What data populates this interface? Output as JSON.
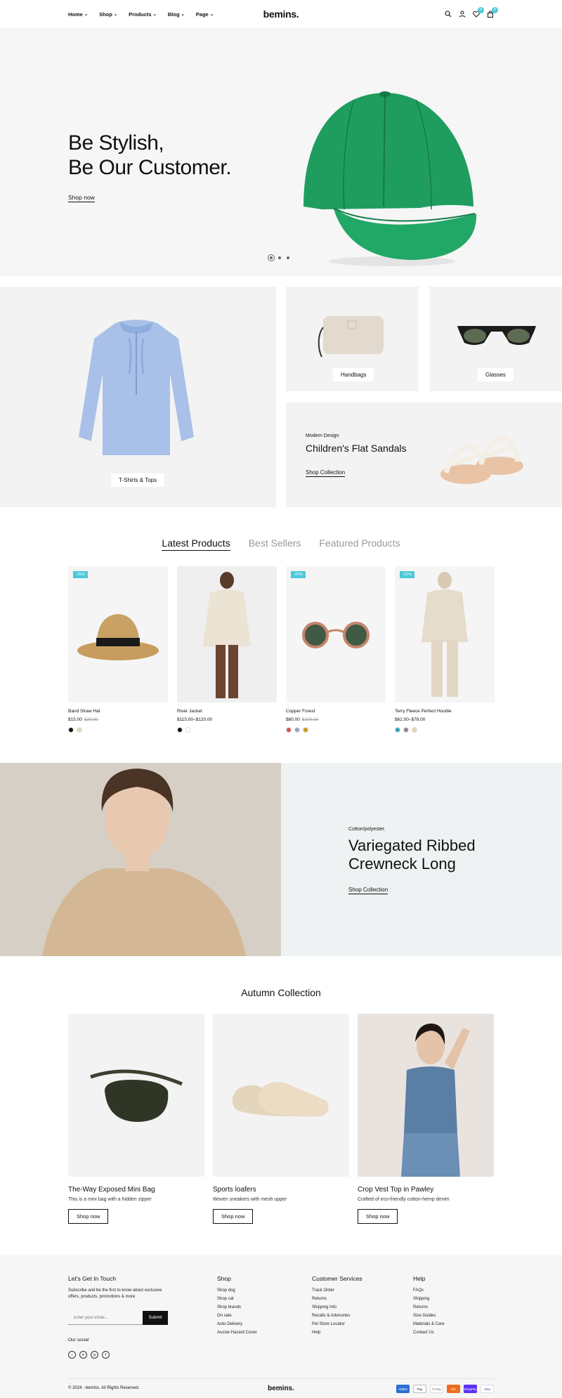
{
  "header": {
    "nav": [
      "Home",
      "Shop",
      "Products",
      "Blog",
      "Page"
    ],
    "logo": "bemins.",
    "wishlist_count": "0",
    "cart_count": "0"
  },
  "hero": {
    "line1": "Be Stylish,",
    "line2": "Be Our Customer.",
    "cta": "Shop now"
  },
  "categories": {
    "tops": "T-Shirts & Tops",
    "handbags": "Handbags",
    "glasses": "Glasses",
    "sandals": {
      "eyebrow": "Modern Design",
      "title": "Children's Flat Sandals",
      "cta": "Shop Collection"
    }
  },
  "tabs": [
    "Latest Products",
    "Best Sellers",
    "Featured Products"
  ],
  "products": [
    {
      "name": "Band Straw Hat",
      "price": "$15.00",
      "old": "$20.00",
      "badge": "-25%",
      "swatches": [
        "#111111",
        "#e8d3b5"
      ]
    },
    {
      "name": "River Jacket",
      "price": "$115.00–$120.00",
      "old": "",
      "badge": "",
      "swatches": [
        "#111111",
        "#ffffff"
      ]
    },
    {
      "name": "Copper Forest",
      "price": "$80.00",
      "old": "$100.00",
      "badge": "-20%",
      "swatches": [
        "#d9534f",
        "#9aa4c7",
        "#c99a1a"
      ]
    },
    {
      "name": "Terry Fleece Perfect Hoodie",
      "price": "$62.00–$78.00",
      "old": "",
      "badge": "-21%",
      "swatches": [
        "#2aa6b8",
        "#8a8a8a",
        "#e8d3b5"
      ]
    }
  ],
  "banner": {
    "eyebrow": "Cotton/polyester.",
    "line1": "Variegated Ribbed",
    "line2": "Crewneck Long",
    "cta": "Shop Collection"
  },
  "autumn": {
    "title": "Autumn Collection",
    "items": [
      {
        "title": "The-Way Exposed Mini Bag",
        "desc": "This is a mini bag with a hidden zipper",
        "cta": "Shop now"
      },
      {
        "title": "Sports loafers",
        "desc": "Woven sneakers with mesh upper",
        "cta": "Shop now"
      },
      {
        "title": "Crop Vest Top in Pawley",
        "desc": "Crafted of eco-friendly cotton-hemp denim",
        "cta": "Shop now"
      }
    ]
  },
  "footer": {
    "contact": {
      "title": "Let's Get In Touch",
      "text1": "Subscribe and be the first to know about exclusive",
      "text2": "offers, products, promotions & more",
      "placeholder": "Enter your email...",
      "submit": "Submit",
      "social_label": "Our social"
    },
    "shop": {
      "title": "Shop",
      "links": [
        "Shop dog",
        "Shop cat",
        "Shop brands",
        "On sale",
        "Auto-Delivery",
        "Aussie Hazard Cover"
      ]
    },
    "service": {
      "title": "Customer Services",
      "links": [
        "Track Order",
        "Returns",
        "Shipping Info",
        "Recalls & Advisories",
        "Pet Store Locator",
        "Help"
      ]
    },
    "help": {
      "title": "Help",
      "links": [
        "FAQs",
        "Shipping",
        "Returns",
        "Size Guides",
        "Materials & Care",
        "Contact Us"
      ]
    },
    "copyright": "© 2024 - bemins. All Rights Reserved.",
    "logo": "bemins.",
    "payments": [
      "AMEX",
      "Pay",
      "G Pay",
      "MC",
      "ShopPay",
      "Visa"
    ]
  }
}
